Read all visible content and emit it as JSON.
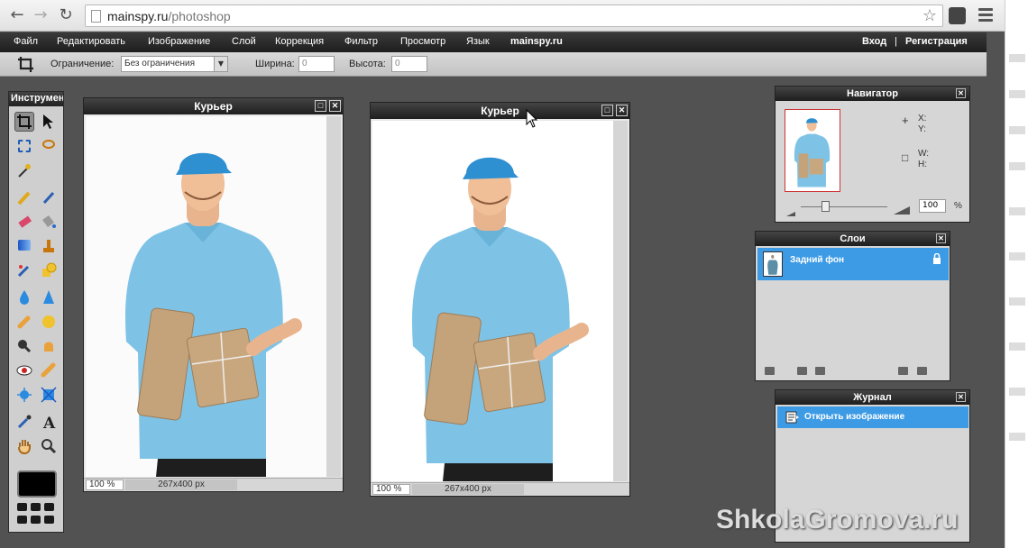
{
  "browser": {
    "url_host": "mainspy.ru",
    "url_path": "/photoshop"
  },
  "menu": {
    "items": [
      "Файл",
      "Редактировать",
      "Изображение",
      "Слой",
      "Коррекция",
      "Фильтр",
      "Просмотр",
      "Язык",
      "mainspy.ru"
    ],
    "login": "Вход",
    "separator": "|",
    "register": "Регистрация"
  },
  "options": {
    "constraint_label": "Ограничение:",
    "constraint_value": "Без ограничения",
    "width_label": "Ширина:",
    "width_value": "0",
    "height_label": "Высота:",
    "height_value": "0"
  },
  "tools": {
    "title": "Инструменты"
  },
  "documents": [
    {
      "title": "Курьер",
      "zoom": "100 %",
      "size": "267x400 px"
    },
    {
      "title": "Курьер",
      "zoom": "100 %",
      "size": "267x400 px"
    }
  ],
  "navigator": {
    "title": "Навигатор",
    "x_label": "X:",
    "y_label": "Y:",
    "w_label": "W:",
    "h_label": "H:",
    "zoom": "100",
    "percent": "%"
  },
  "layers": {
    "title": "Слои",
    "items": [
      {
        "name": "Задний фон"
      }
    ]
  },
  "history": {
    "title": "Журнал",
    "items": [
      {
        "name": "Открыть изображение"
      }
    ]
  },
  "watermark": "ShkolaGromova.ru",
  "colors": {
    "menu_bg": "#1e1e1e",
    "workspace": "#525252",
    "selection": "#3d9be5",
    "shirt": "#7ec3e6",
    "cap": "#2e8fd1",
    "box": "#c4a27a"
  }
}
